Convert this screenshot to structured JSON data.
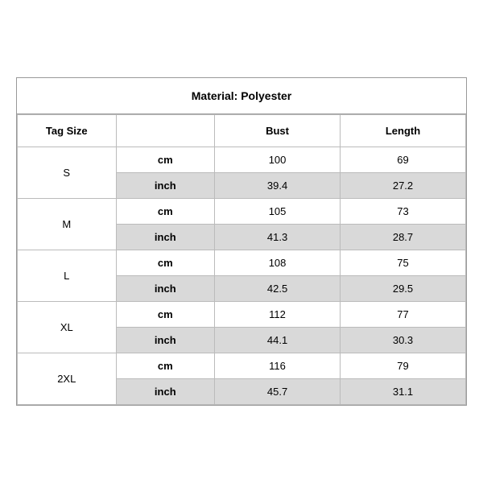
{
  "title": "Material: Polyester",
  "headers": {
    "tag_size": "Tag Size",
    "bust": "Bust",
    "length": "Length"
  },
  "sizes": [
    {
      "tag": "S",
      "cm_bust": "100",
      "cm_length": "69",
      "inch_bust": "39.4",
      "inch_length": "27.2"
    },
    {
      "tag": "M",
      "cm_bust": "105",
      "cm_length": "73",
      "inch_bust": "41.3",
      "inch_length": "28.7"
    },
    {
      "tag": "L",
      "cm_bust": "108",
      "cm_length": "75",
      "inch_bust": "42.5",
      "inch_length": "29.5"
    },
    {
      "tag": "XL",
      "cm_bust": "112",
      "cm_length": "77",
      "inch_bust": "44.1",
      "inch_length": "30.3"
    },
    {
      "tag": "2XL",
      "cm_bust": "116",
      "cm_length": "79",
      "inch_bust": "45.7",
      "inch_length": "31.1"
    }
  ],
  "unit_cm": "cm",
  "unit_inch": "inch"
}
